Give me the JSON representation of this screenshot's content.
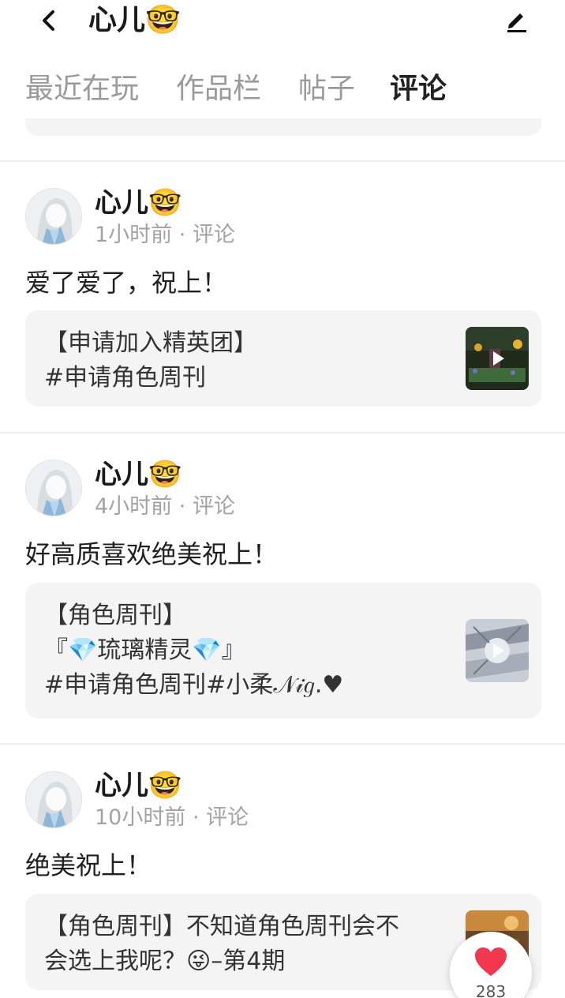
{
  "header": {
    "title": "心儿🤓"
  },
  "tabs": [
    {
      "label": "最近在玩"
    },
    {
      "label": "作品栏"
    },
    {
      "label": "帖子"
    },
    {
      "label": "评论",
      "active": true
    }
  ],
  "colors": {
    "accent": "#ff6a1f",
    "heart": "#f2384f"
  },
  "posts": [
    {
      "author": "心儿🤓",
      "time": "1小时前",
      "type": "评论",
      "comment": "爱了爱了，祝上！",
      "ref_lines": [
        "【申请加入精英团】",
        "#申请角色周刊"
      ]
    },
    {
      "author": "心儿🤓",
      "time": "4小时前",
      "type": "评论",
      "comment": "好高质喜欢绝美祝上！",
      "ref_lines": [
        "【角色周刊】",
        "『💎琉璃精灵💎』",
        "#申请角色周刊#小柔𝒩𝒾𝑔.♥"
      ]
    },
    {
      "author": "心儿🤓",
      "time": "10小时前",
      "type": "评论",
      "comment": "绝美祝上！",
      "ref_lines": [
        "【角色周刊】不知道角色周刊会不",
        "会选上我呢？😜–第4期"
      ]
    }
  ],
  "like": {
    "count": "283",
    "icon": "heart-icon"
  },
  "icons": {
    "back": "chevron-left-icon",
    "edit": "pencil-icon",
    "play": "play-icon"
  }
}
